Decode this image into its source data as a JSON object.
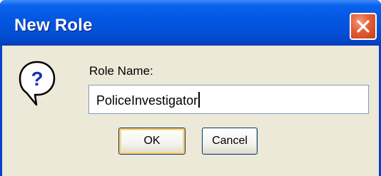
{
  "dialog": {
    "title": "New Role",
    "close_icon": "close-icon",
    "prompt_icon": "question-icon",
    "label": "Role Name:",
    "input_value": "PoliceInvestigator",
    "ok_label": "OK",
    "cancel_label": "Cancel"
  },
  "colors": {
    "titlebar": "#0457e2",
    "client_bg": "#ece9d8",
    "close_button": "#e45c32",
    "input_border": "#7f9db9",
    "button_border": "#003c74",
    "default_button_highlight": "#ffcc66"
  }
}
